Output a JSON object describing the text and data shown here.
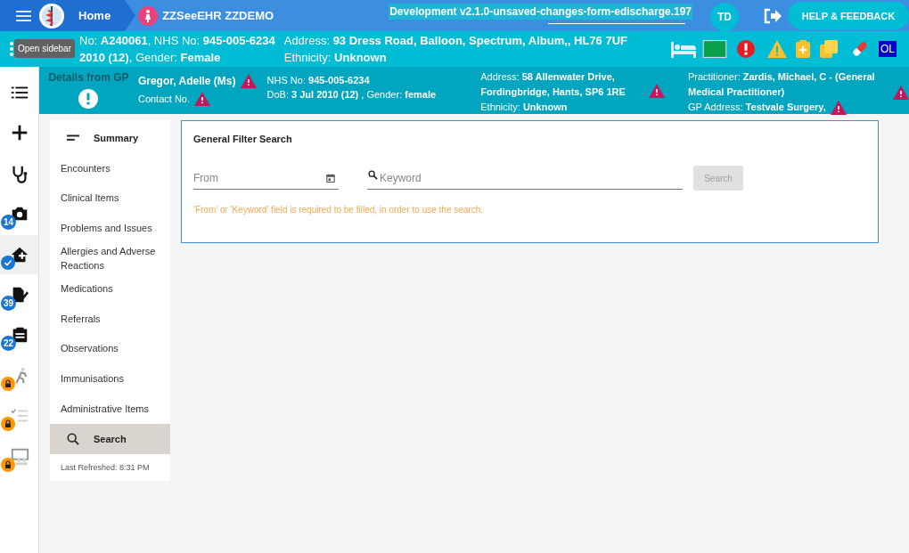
{
  "topbar": {
    "home": "Home",
    "app_name": "ZZSeeEHR ZZDEMO",
    "version": "Development v2.1.0-unsaved-changes-form-edischarge.197",
    "user_initials": "TD",
    "help_button": "HELP & FEEDBACK"
  },
  "patient_banner": {
    "line1": "No: **A240061**, NHS No: **945-005-6234**",
    "line2": "**2010 (12)**, Gender: **Female**",
    "address": "Address: **93 Dress Road, Balloon, Spectrum, Album,, HL76 7UF**",
    "ethnicity": "Ethnicity: **Unknown**",
    "tooltip": "Open sidebar",
    "status_icons": [
      {
        "kind": "bed"
      },
      {
        "kind": "card"
      },
      {
        "kind": "alert"
      },
      {
        "kind": "warning"
      },
      {
        "kind": "clipboard"
      },
      {
        "kind": "copies"
      },
      {
        "kind": "pill"
      },
      {
        "kind": "text",
        "text": "OL"
      }
    ]
  },
  "gp_details": {
    "title": "Details from GP",
    "name": "Gregor, Adelle (Ms)",
    "contact": "Contact No.",
    "nhs": "NHS No: **945-005-6234**",
    "dob": "DoB: **3 Jul 2010 (12)** , Gender: **female**",
    "address": "Address: **58 Allenwater Drive, Fordingbridge, Hants, SP6 1RE**",
    "ethnicity": "Ethnicity: **Unknown**",
    "practitioner": "Practitioner: **Zardis, Michael, C - (General Medical Practitioner)**",
    "gp_address": "GP Address: **Testvale Surgery,**"
  },
  "rail": [
    {
      "kind": "list",
      "selected": false
    },
    {
      "kind": "add",
      "selected": false
    },
    {
      "kind": "stethoscope",
      "selected": false
    },
    {
      "kind": "camera",
      "selected": false,
      "badge": {
        "kind": "count",
        "text": "14"
      }
    },
    {
      "kind": "home",
      "selected": true,
      "badge": {
        "kind": "check"
      }
    },
    {
      "kind": "document",
      "selected": false,
      "badge": {
        "kind": "count",
        "text": "39"
      }
    },
    {
      "kind": "clipboard",
      "selected": false,
      "badge": {
        "kind": "count",
        "text": "22"
      }
    },
    {
      "kind": "walker",
      "selected": false,
      "badge": {
        "kind": "lock"
      }
    },
    {
      "kind": "checklist",
      "selected": false,
      "badge": {
        "kind": "lock"
      }
    },
    {
      "kind": "people",
      "selected": false,
      "badge": {
        "kind": "lock"
      }
    }
  ],
  "nav": {
    "items": [
      {
        "label": "Summary",
        "kind": "summary",
        "selected": false
      },
      {
        "label": "Encounters",
        "kind": "plain",
        "selected": false
      },
      {
        "label": "Clinical Items",
        "kind": "plain",
        "selected": false
      },
      {
        "label": "Problems and Issues",
        "kind": "plain",
        "selected": false
      },
      {
        "label": "Allergies and Adverse Reactions",
        "kind": "plain",
        "selected": false
      },
      {
        "label": "Medications",
        "kind": "plain",
        "selected": false
      },
      {
        "label": "Referrals",
        "kind": "plain",
        "selected": false
      },
      {
        "label": "Observations",
        "kind": "plain",
        "selected": false
      },
      {
        "label": "Immunisations",
        "kind": "plain",
        "selected": false
      },
      {
        "label": "Administrative Items",
        "kind": "plain",
        "selected": false
      },
      {
        "label": "Search",
        "kind": "search",
        "selected": true
      }
    ],
    "last_refreshed": "Last Refreshed: 8:31 PM"
  },
  "search_card": {
    "title": "General Filter Search",
    "from": {
      "placeholder": "From"
    },
    "keyword": {
      "placeholder": "Keyword"
    },
    "button": {
      "label": "Search",
      "disabled": true
    },
    "hint": "'From' or 'Keyword' field is required to be filled, in order to use the search."
  }
}
